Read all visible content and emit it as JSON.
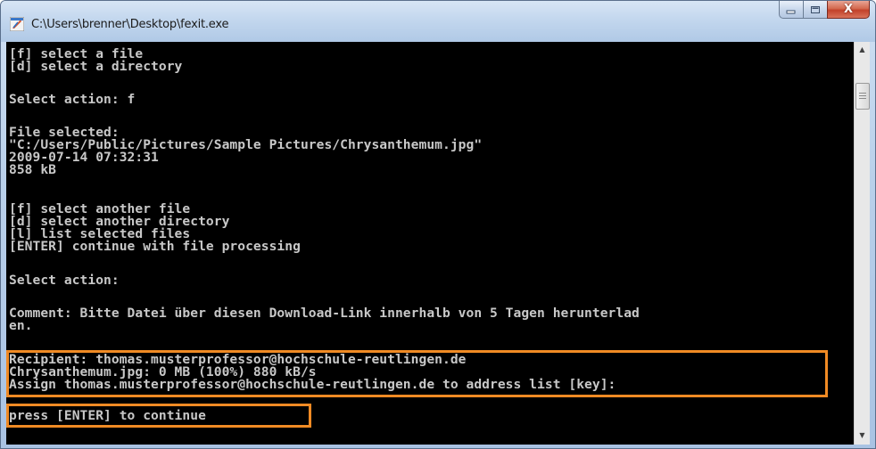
{
  "window": {
    "title": "C:\\Users\\brenner\\Desktop\\fexit.exe",
    "app_icon": "feather-exe-icon"
  },
  "caption_buttons": {
    "minimize_icon": "minimize-icon",
    "maximize_icon": "maximize-icon",
    "close_icon": "close-icon",
    "minimize_glyph": "",
    "maximize_glyph": "",
    "close_glyph": "X"
  },
  "console": {
    "lines": [
      "[f] select a file",
      "[d] select a directory",
      "",
      "Select action: f",
      "",
      "File selected:",
      "\"C:/Users/Public/Pictures/Sample Pictures/Chrysanthemum.jpg\"",
      "2009-07-14 07:32:31",
      "858 kB",
      "",
      "[f] select another file",
      "[d] select another directory",
      "[l] list selected files",
      "[ENTER] continue with file processing",
      "",
      "Select action:",
      "",
      "Comment: Bitte Datei über diesen Download-Link innerhalb von 5 Tagen herunterlad",
      "en.",
      "",
      "Recipient: thomas.musterprofessor@hochschule-reutlingen.de",
      "Chrysanthemum.jpg: 0 MB (100%) 880 kB/s",
      "Assign thomas.musterprofessor@hochschule-reutlingen.de to address list [key]:",
      "",
      "press [ENTER] to continue"
    ]
  },
  "highlight_color": "#f08a24",
  "console_bg": "#000000",
  "console_fg": "#c8c8c8",
  "scrollbar": {
    "up_glyph": "▲",
    "down_glyph": "▼"
  }
}
